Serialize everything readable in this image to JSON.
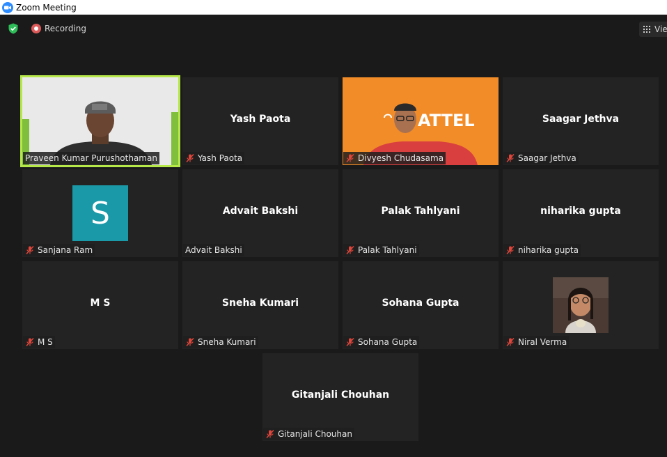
{
  "window": {
    "title": "Zoom Meeting"
  },
  "toolbar": {
    "recording_label": "Recording",
    "view_label": "View"
  },
  "tiles": [
    {
      "name_center": "",
      "tag": "Praveen Kumar Purushothaman",
      "muted": false
    },
    {
      "name_center": "Yash Paota",
      "tag": "Yash Paota",
      "muted": true
    },
    {
      "name_center": "",
      "tag": "Divyesh Chudasama",
      "muted": true,
      "banner_text": "ATTEL"
    },
    {
      "name_center": "Saagar Jethva",
      "tag": "Saagar Jethva",
      "muted": true
    },
    {
      "name_center": "",
      "tag": "Sanjana Ram",
      "muted": true,
      "avatar_letter": "S"
    },
    {
      "name_center": "Advait Bakshi",
      "tag": "Advait Bakshi",
      "muted": false
    },
    {
      "name_center": "Palak Tahlyani",
      "tag": "Palak Tahlyani",
      "muted": true
    },
    {
      "name_center": "niharika gupta",
      "tag": "niharika gupta",
      "muted": true
    },
    {
      "name_center": "M S",
      "tag": "M S",
      "muted": true
    },
    {
      "name_center": "Sneha Kumari",
      "tag": "Sneha Kumari",
      "muted": true
    },
    {
      "name_center": "Sohana Gupta",
      "tag": "Sohana Gupta",
      "muted": true
    },
    {
      "name_center": "",
      "tag": "Niral Verma",
      "muted": true
    },
    {
      "name_center": "Gitanjali Chouhan",
      "tag": "Gitanjali Chouhan",
      "muted": true
    }
  ],
  "colors": {
    "active_speaker": "#b7e84a",
    "mic_off": "#e0463b",
    "avatar_bg": "#1a99a8",
    "banner_bg": "#f28c28"
  }
}
